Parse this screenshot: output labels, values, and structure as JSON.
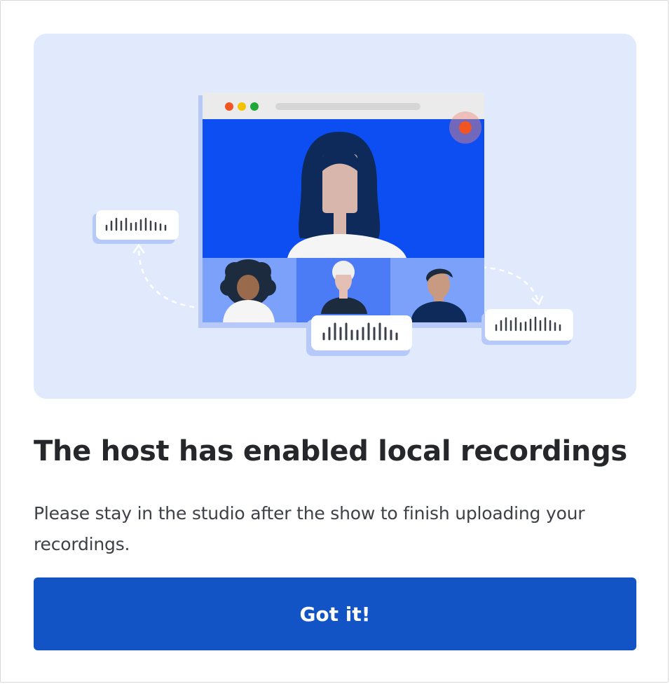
{
  "dialog": {
    "title": "The host has enabled local recordings",
    "description": "Please stay in the studio after the show to finish uploading your recordings.",
    "confirm_label": "Got it!"
  },
  "illustration": {
    "subject": "video call recording with audio waveforms",
    "icons": [
      "browser-window",
      "recording-indicator",
      "participant-avatar",
      "waveform"
    ]
  },
  "colors": {
    "panel_background": "#e1eafd",
    "video_blue": "#0c4ef1",
    "button_blue": "#1254c6",
    "record_red": "#f05523"
  }
}
